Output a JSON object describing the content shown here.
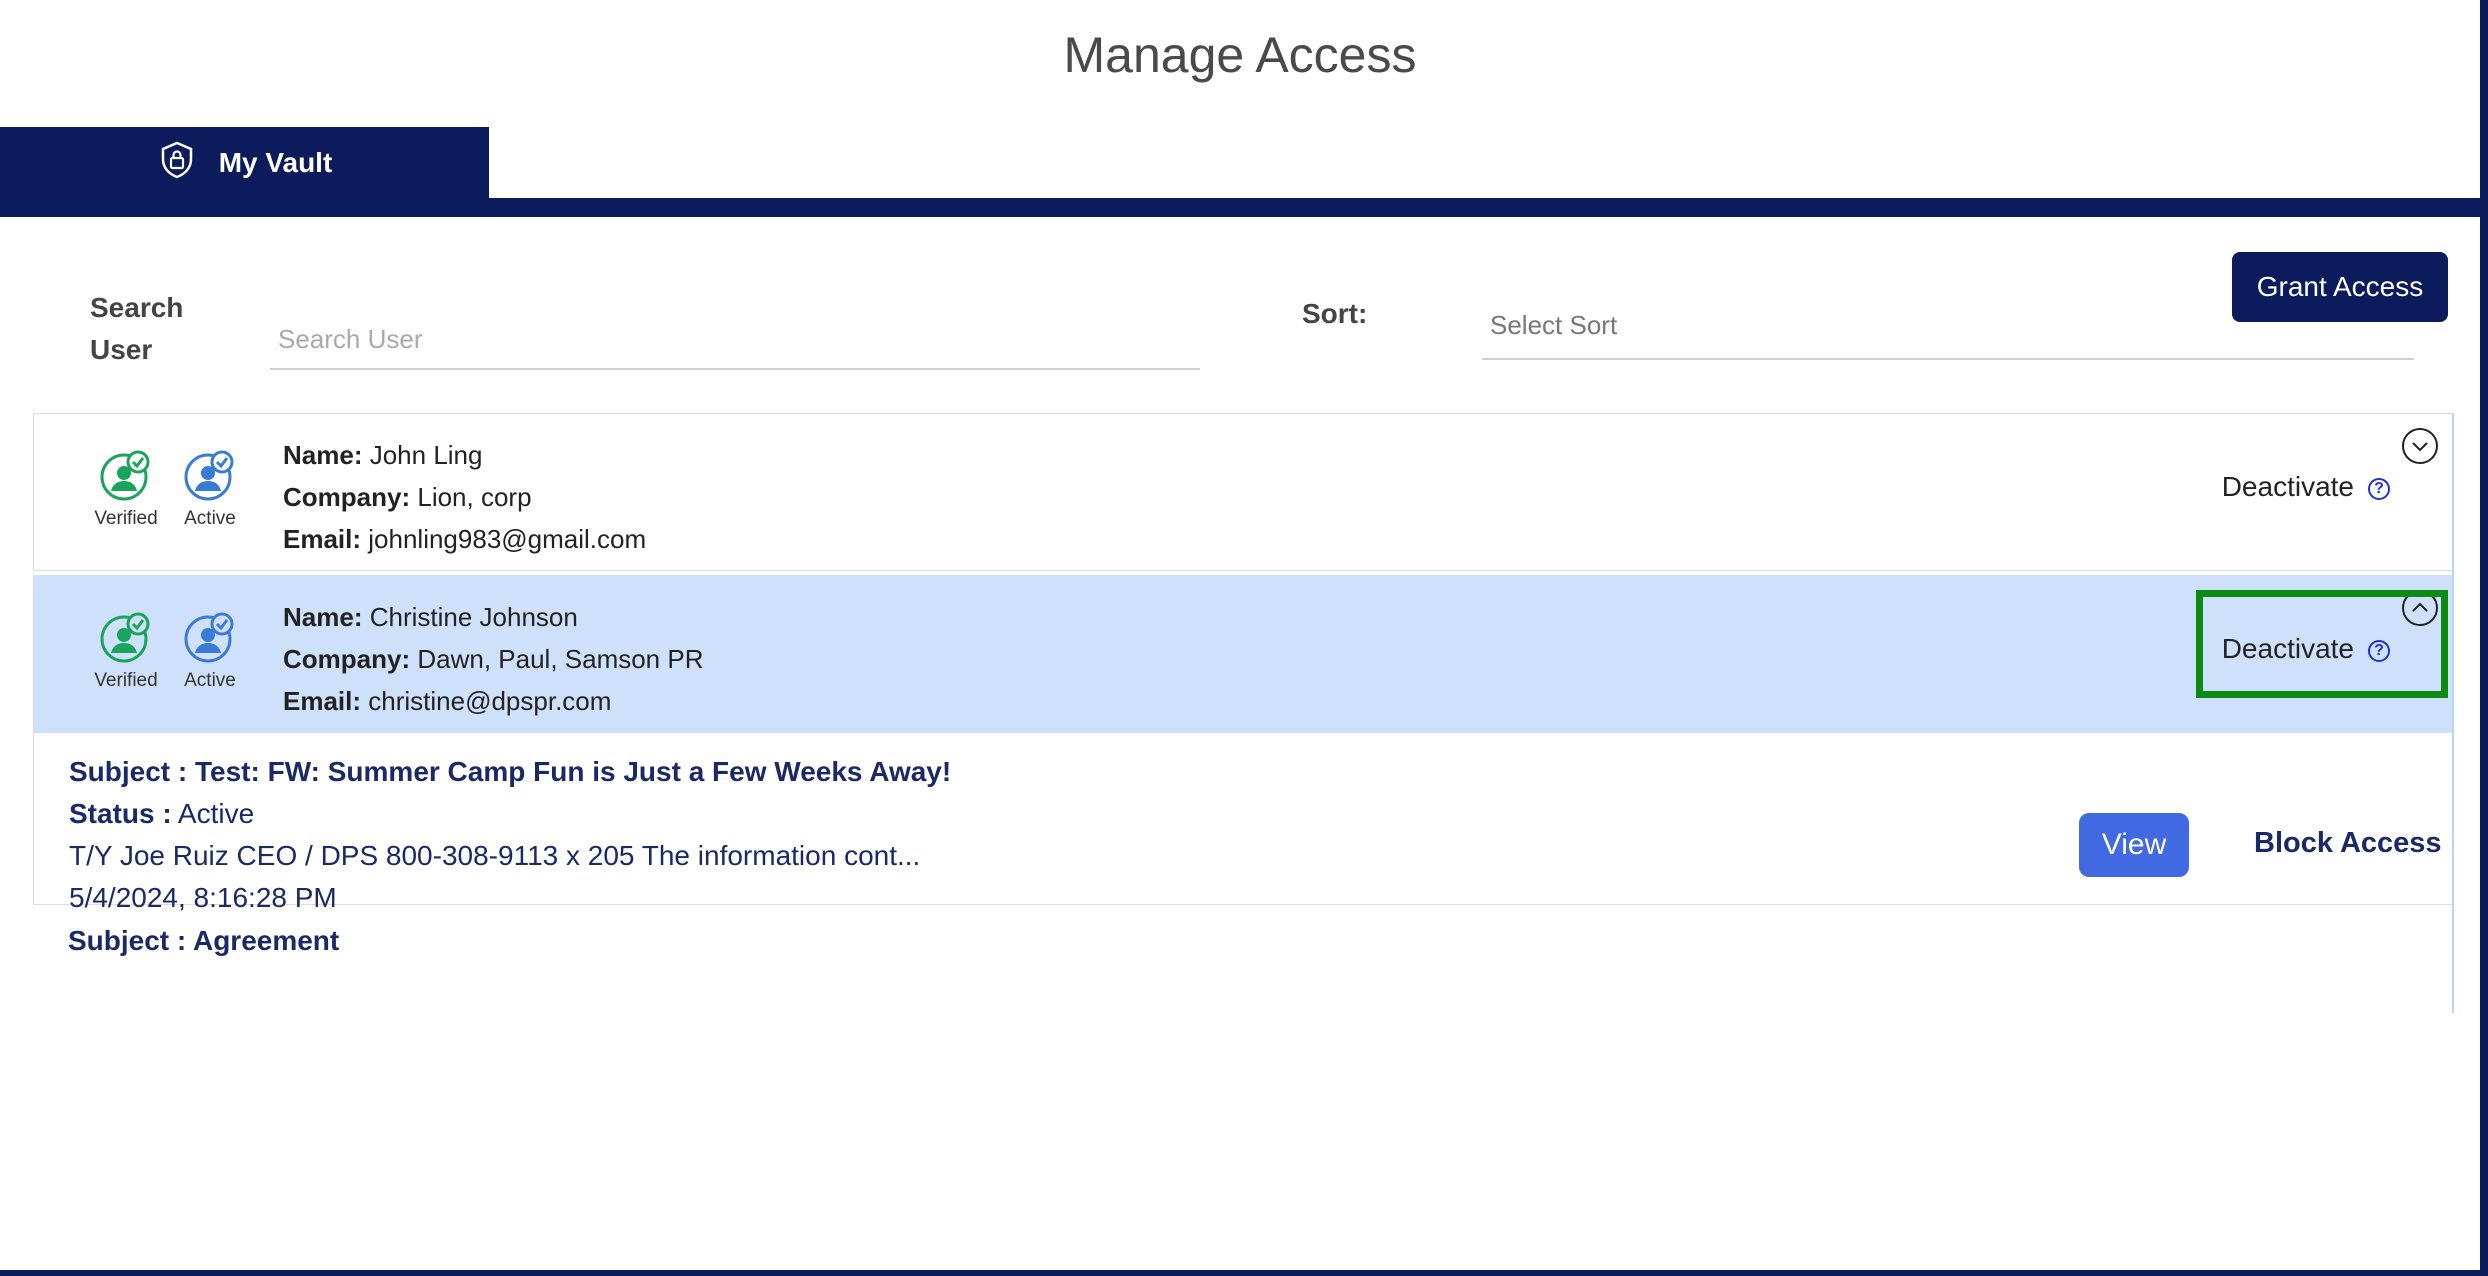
{
  "page": {
    "title": "Manage Access"
  },
  "tabs": [
    {
      "label": "My Vault",
      "icon": "shield-lock-icon"
    }
  ],
  "toolbar": {
    "search_label": "Search User",
    "search_placeholder": "Search User",
    "sort_label": "Sort:",
    "sort_placeholder": "Select Sort",
    "grant_label": "Grant Access"
  },
  "users": [
    {
      "badges": {
        "verified": "Verified",
        "active": "Active"
      },
      "name_key": "Name:",
      "name": "John Ling",
      "company_key": "Company:",
      "company": "Lion, corp",
      "email_key": "Email:",
      "email": "johnling983@gmail.com",
      "action": "Deactivate",
      "help": "?"
    },
    {
      "badges": {
        "verified": "Verified",
        "active": "Active"
      },
      "name_key": "Name:",
      "name": "Christine Johnson",
      "company_key": "Company:",
      "company": "Dawn, Paul, Samson PR",
      "email_key": "Email:",
      "email": "christine@dpspr.com",
      "action": "Deactivate",
      "help": "?"
    }
  ],
  "messages": [
    {
      "subject": "Subject : Test: FW: Summer Camp Fun is Just a Few Weeks Away!",
      "status_key": "Status :",
      "status": "Active",
      "preview": "T/Y Joe Ruiz CEO / DPS 800-308-9113 x 205 The information cont...",
      "timestamp": "5/4/2024, 8:16:28 PM",
      "view_label": "View",
      "block_label": "Block Access"
    }
  ],
  "next_subject": "Subject : Agreement",
  "colors": {
    "navy": "#0c1b5b",
    "selected_row": "#cfe0fb",
    "verified_green": "#1aa35a",
    "active_blue": "#3a7bd5",
    "view_button": "#4169e1",
    "highlight_green": "#0c8a12"
  }
}
